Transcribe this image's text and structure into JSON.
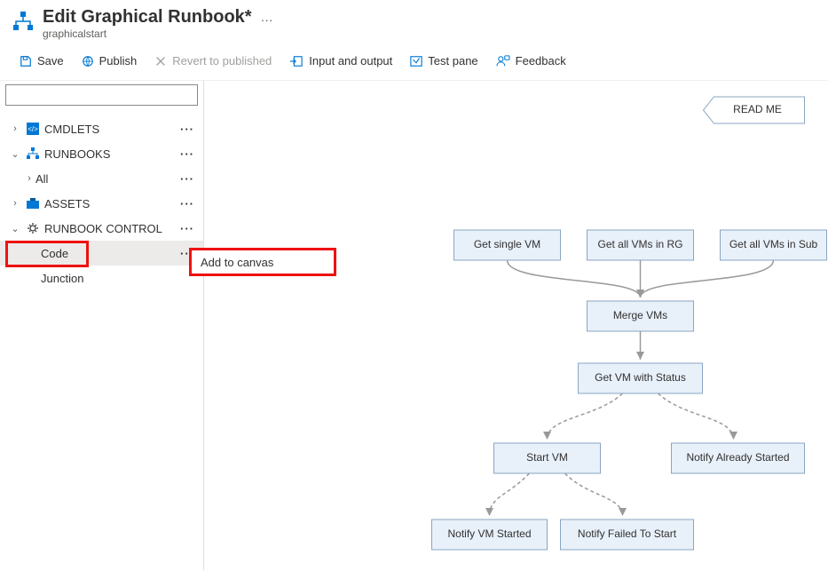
{
  "header": {
    "title": "Edit Graphical Runbook*",
    "subtitle": "graphicalstart"
  },
  "toolbar": {
    "save": "Save",
    "publish": "Publish",
    "revert": "Revert to published",
    "input_output": "Input and output",
    "test_pane": "Test pane",
    "feedback": "Feedback"
  },
  "sidebar": {
    "cmdlets": "CMDLETS",
    "runbooks": "RUNBOOKS",
    "all": "All",
    "assets": "ASSETS",
    "runbook_control": "RUNBOOK CONTROL",
    "code": "Code",
    "junction": "Junction"
  },
  "context_menu": {
    "add_to_canvas": "Add to canvas"
  },
  "canvas": {
    "readme": "READ ME",
    "get_single_vm": "Get single VM",
    "get_vms_rg": "Get all VMs in RG",
    "get_vms_sub": "Get all VMs in Sub",
    "merge_vms": "Merge VMs",
    "get_vm_status": "Get VM with Status",
    "start_vm": "Start VM",
    "notify_started_already": "Notify Already Started",
    "notify_vm_started": "Notify VM Started",
    "notify_failed": "Notify Failed To Start"
  }
}
